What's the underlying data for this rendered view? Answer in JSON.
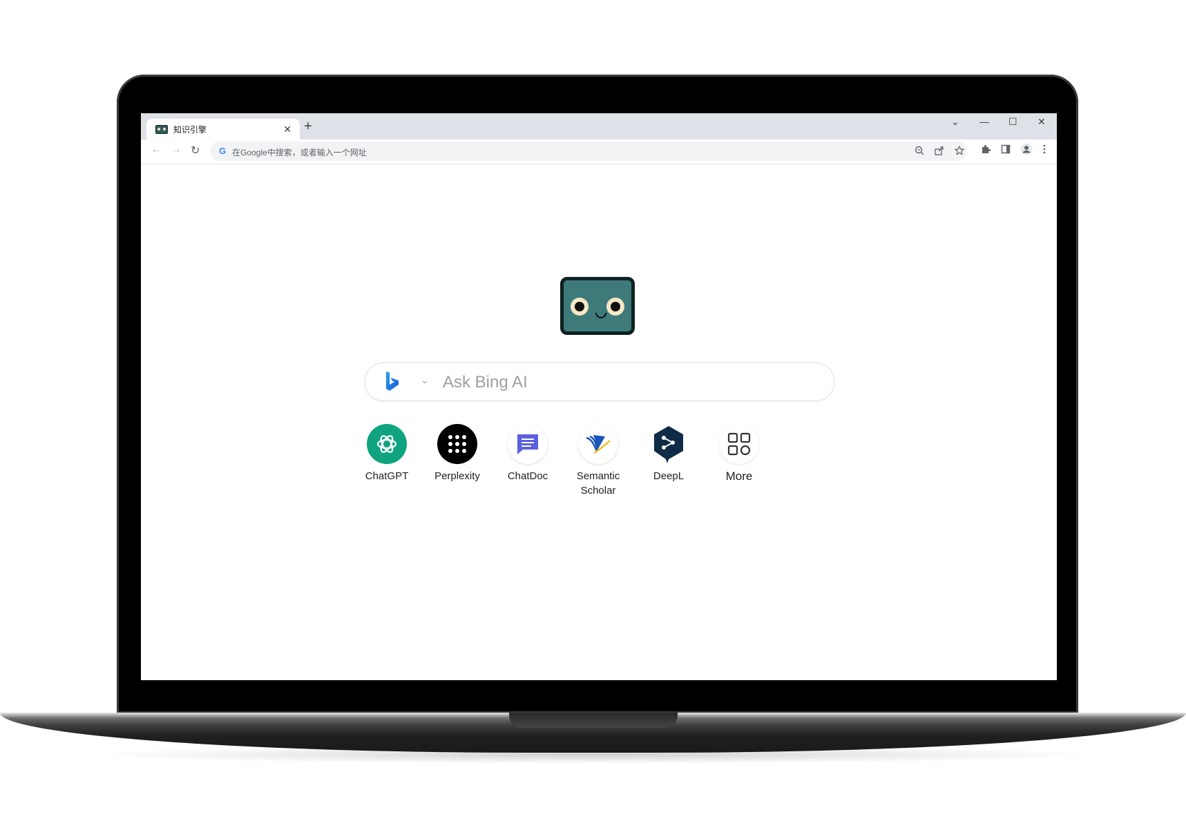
{
  "browser": {
    "tab": {
      "title": "知识引擎",
      "close": "✕"
    },
    "new_tab": "+",
    "window_controls": {
      "tabs_menu": "⌄",
      "minimize": "—",
      "maximize": "☐",
      "close": "✕"
    },
    "omnibox": {
      "placeholder": "在Google中搜索，或者输入一个网址",
      "engine_icon": "G"
    },
    "nav": {
      "back": "←",
      "forward": "→",
      "reload": "↻"
    }
  },
  "page": {
    "search": {
      "placeholder": "Ask Bing AI"
    },
    "shortcuts": [
      {
        "label": "ChatGPT",
        "icon": "chatgpt-icon",
        "color": "#10a37f"
      },
      {
        "label": "Perplexity",
        "icon": "perplexity-icon",
        "color": "#000000"
      },
      {
        "label": "ChatDoc",
        "icon": "chatdoc-icon",
        "color": "#5b5fe0"
      },
      {
        "label": "Semantic\nScholar",
        "icon": "semantic-scholar-icon",
        "color": "#1857b6"
      },
      {
        "label": "DeepL",
        "icon": "deepl-icon",
        "color": "#0f2b46"
      },
      {
        "label": "More",
        "icon": "more-grid-icon",
        "color": "#333333"
      }
    ]
  }
}
